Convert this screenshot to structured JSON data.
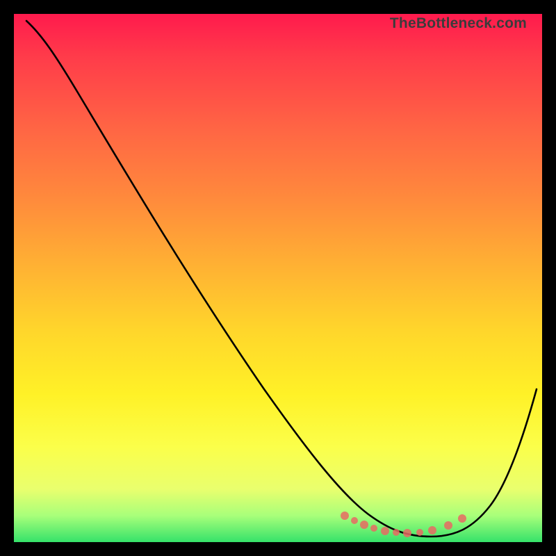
{
  "watermark": "TheBottleneck.com",
  "colors": {
    "curve": "#000000",
    "dots": "#e86a63",
    "gradient_top": "#ff1a4d",
    "gradient_bottom": "#35e26a"
  },
  "chart_data": {
    "type": "line",
    "title": "",
    "xlabel": "",
    "ylabel": "",
    "xlim": [
      0,
      100
    ],
    "ylim": [
      0,
      100
    ],
    "series": [
      {
        "name": "bottleneck-curve",
        "x": [
          0,
          4,
          10,
          20,
          30,
          40,
          50,
          58,
          64,
          68,
          72,
          76,
          80,
          84,
          88,
          92,
          96,
          100
        ],
        "values": [
          100,
          99,
          94,
          82,
          69,
          55,
          42,
          30,
          20,
          13,
          8,
          4,
          2,
          1,
          3,
          9,
          19,
          32
        ]
      }
    ],
    "minimum_region_fraction": [
      0.62,
      0.86
    ],
    "dot_cluster": {
      "x": [
        62,
        65,
        67,
        69,
        71,
        73,
        75,
        78,
        81,
        84,
        86
      ],
      "values": [
        6,
        5,
        4,
        3,
        3,
        3,
        3,
        3,
        4,
        5,
        6
      ]
    }
  }
}
